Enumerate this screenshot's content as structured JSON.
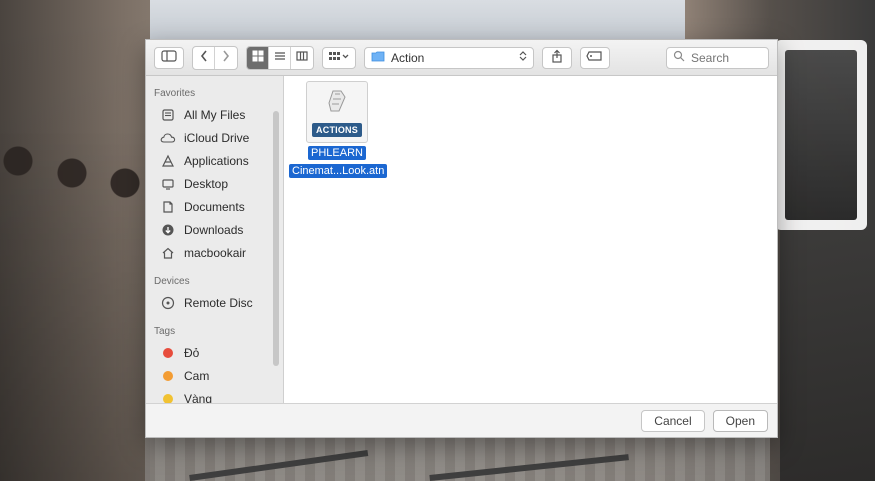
{
  "toolbar": {
    "path_label": "Action",
    "search_placeholder": "Search",
    "icons": {
      "sidebar_toggle": "sidebar-toggle-icon",
      "back": "chevron-left-icon",
      "forward": "chevron-right-icon",
      "view_icons": "grid-icon",
      "view_list": "list-icon",
      "view_columns": "columns-icon",
      "arrange": "grid-dropdown-icon",
      "share": "share-icon",
      "tag": "tag-icon",
      "search": "magnifier-icon",
      "folder": "folder-icon",
      "updown": "updown-chevrons-icon"
    }
  },
  "sidebar": {
    "favorites_title": "Favorites",
    "favorites": [
      {
        "label": "All My Files",
        "icon": "all-my-files-icon"
      },
      {
        "label": "iCloud Drive",
        "icon": "cloud-icon"
      },
      {
        "label": "Applications",
        "icon": "applications-icon"
      },
      {
        "label": "Desktop",
        "icon": "desktop-icon"
      },
      {
        "label": "Documents",
        "icon": "documents-icon"
      },
      {
        "label": "Downloads",
        "icon": "downloads-icon"
      },
      {
        "label": "macbookair",
        "icon": "home-icon"
      }
    ],
    "devices_title": "Devices",
    "devices": [
      {
        "label": "Remote Disc",
        "icon": "disc-icon"
      }
    ],
    "tags_title": "Tags",
    "tags": [
      {
        "label": "Đỏ",
        "color": "#e74c3c"
      },
      {
        "label": "Cam",
        "color": "#f39c33"
      },
      {
        "label": "Vàng",
        "color": "#f1c232"
      }
    ]
  },
  "files": [
    {
      "badge": "ACTIONS",
      "name_line1": "PHLEARN",
      "name_line2": "Cinemat...Look.atn"
    }
  ],
  "footer": {
    "cancel_label": "Cancel",
    "open_label": "Open"
  }
}
